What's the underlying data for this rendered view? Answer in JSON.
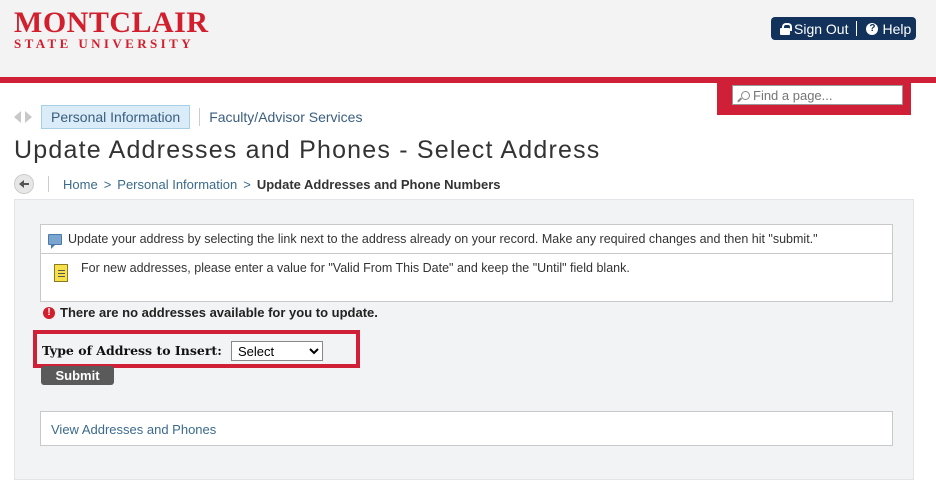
{
  "header": {
    "logo_main": "MONTCLAIR",
    "logo_sub": "STATE UNIVERSITY",
    "sign_out_label": "Sign Out",
    "help_label": "Help"
  },
  "search": {
    "placeholder": "Find a page..."
  },
  "tabs": [
    {
      "label": "Personal Information",
      "active": true
    },
    {
      "label": "Faculty/Advisor Services",
      "active": false
    }
  ],
  "page_title": "Update Addresses and Phones - Select Address",
  "breadcrumb": {
    "home": "Home",
    "personal": "Personal Information",
    "current": "Update Addresses and Phone Numbers",
    "separator": ">"
  },
  "messages": {
    "info": "Update your address by selecting the link next to the address already on your record. Make any required changes and then hit \"submit.\"",
    "note": "For new addresses, please enter a value for \"Valid From This Date\" and keep the \"Until\" field blank.",
    "error": "There are no addresses available for you to update."
  },
  "form": {
    "type_label": "Type of Address to Insert:",
    "select_value": "Select",
    "submit_label": "Submit"
  },
  "view_link": "View Addresses and Phones",
  "colors": {
    "brand_red": "#cf2038",
    "nav_blue": "#12325c",
    "link_blue": "#3b6a8c"
  }
}
